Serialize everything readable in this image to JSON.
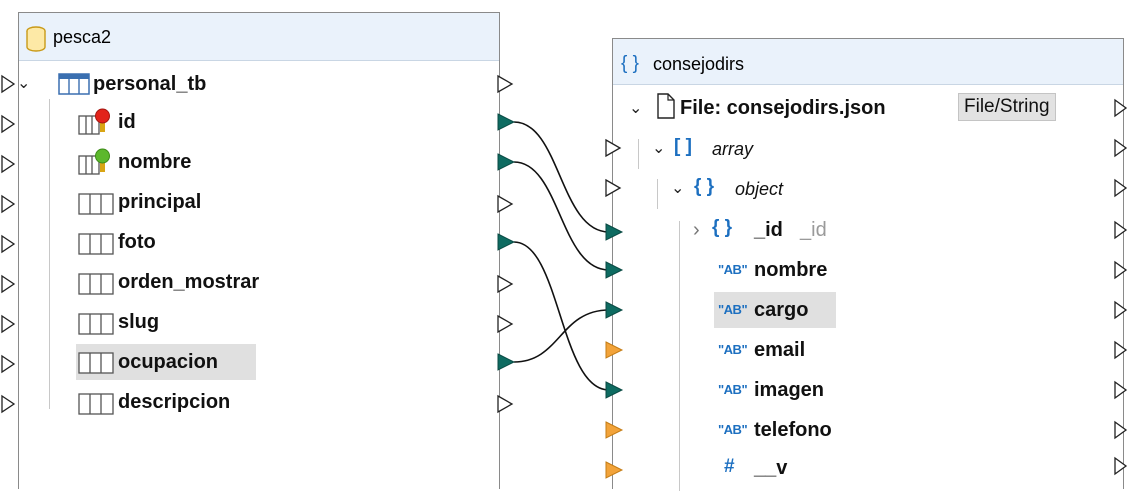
{
  "colors": {
    "connected": "#0e6b61",
    "output_connected": "#0e6b61",
    "unconnected": "#ffffff",
    "optional": "#f2a33a",
    "header_bg": "#eaf2fb",
    "accent": "#1c6fc0"
  },
  "source": {
    "title": "pesca2",
    "table": "personal_tb",
    "fields": [
      {
        "name": "id",
        "icon": "key-red-icon",
        "connected": true,
        "highlight": false
      },
      {
        "name": "nombre",
        "icon": "key-green-icon",
        "connected": true,
        "highlight": false
      },
      {
        "name": "principal",
        "icon": "column-icon",
        "connected": false,
        "highlight": false
      },
      {
        "name": "foto",
        "icon": "column-icon",
        "connected": true,
        "highlight": false
      },
      {
        "name": "orden_mostrar",
        "icon": "column-icon",
        "connected": false,
        "highlight": false
      },
      {
        "name": "slug",
        "icon": "column-icon",
        "connected": false,
        "highlight": false
      },
      {
        "name": "ocupacion",
        "icon": "column-icon",
        "connected": true,
        "highlight": true
      },
      {
        "name": "descripcion",
        "icon": "column-icon",
        "connected": false,
        "highlight": false
      }
    ]
  },
  "target": {
    "title": "consejodirs",
    "file_label": "File: consejodirs.json",
    "file_button": "File/String",
    "array_label": "array",
    "object_label": "object",
    "id_label": "_id",
    "id_type": "_id",
    "brace_open": "{ }",
    "array_brackets": "[ ]",
    "string_icon": "\"AB\"",
    "number_icon": "#",
    "fields": [
      {
        "name": "nombre",
        "type": "string",
        "highlight": false
      },
      {
        "name": "cargo",
        "type": "string",
        "highlight": true
      },
      {
        "name": "email",
        "type": "string",
        "highlight": false
      },
      {
        "name": "imagen",
        "type": "string",
        "highlight": false
      },
      {
        "name": "telefono",
        "type": "string",
        "highlight": false
      },
      {
        "name": "__v",
        "type": "number",
        "highlight": false
      }
    ]
  },
  "mappings": [
    {
      "from": "id",
      "to": "_id"
    },
    {
      "from": "nombre",
      "to": "nombre"
    },
    {
      "from": "foto",
      "to": "imagen"
    },
    {
      "from": "ocupacion",
      "to": "cargo"
    }
  ]
}
